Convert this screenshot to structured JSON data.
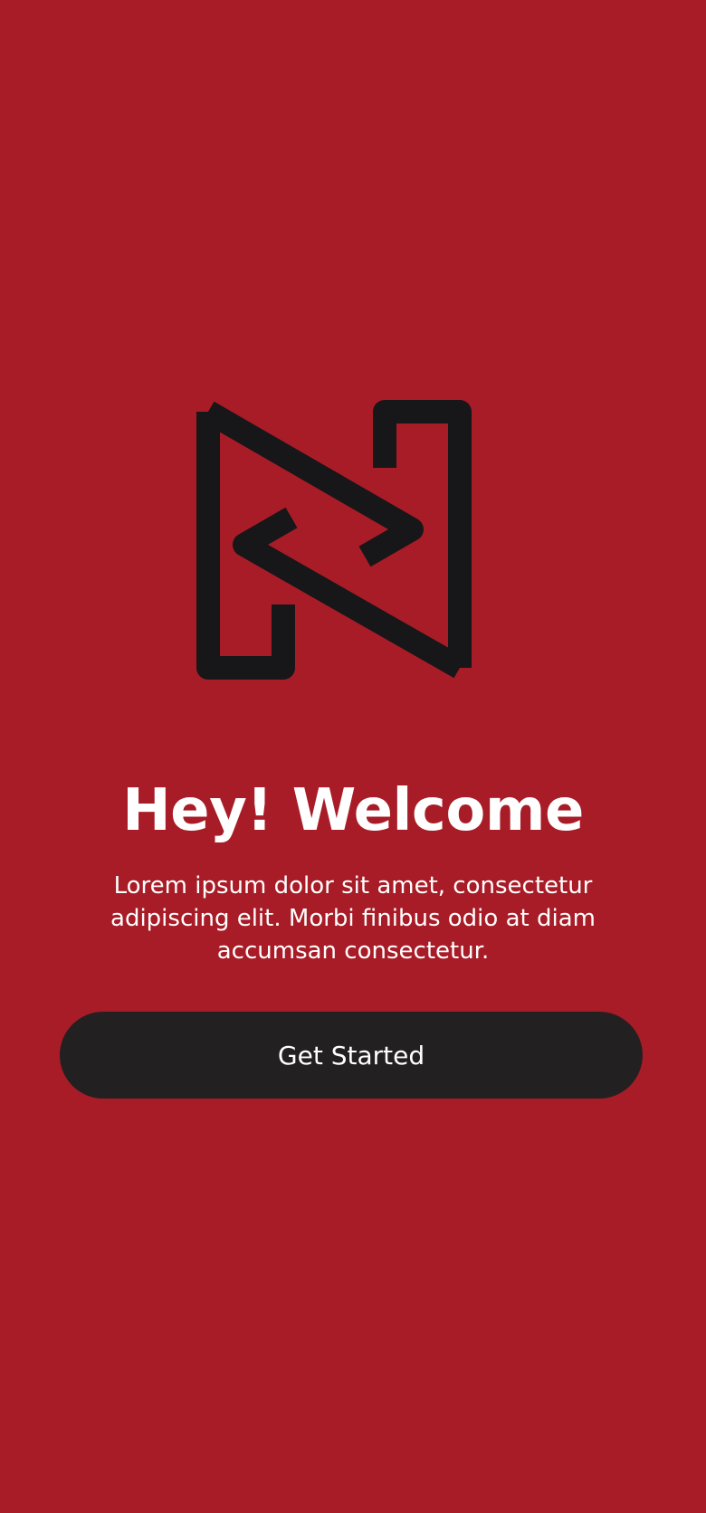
{
  "colors": {
    "background": "#A81C27",
    "logo": "#171618",
    "button_background": "#232021",
    "text": "#FFFFFF"
  },
  "logo": {
    "icon": "brand-logo-icon"
  },
  "welcome": {
    "title": "Hey! Welcome",
    "subtitle": "Lorem ipsum dolor sit amet, consectetur adipiscing elit. Morbi finibus odio at diam accumsan consectetur."
  },
  "cta": {
    "label": "Get Started"
  }
}
